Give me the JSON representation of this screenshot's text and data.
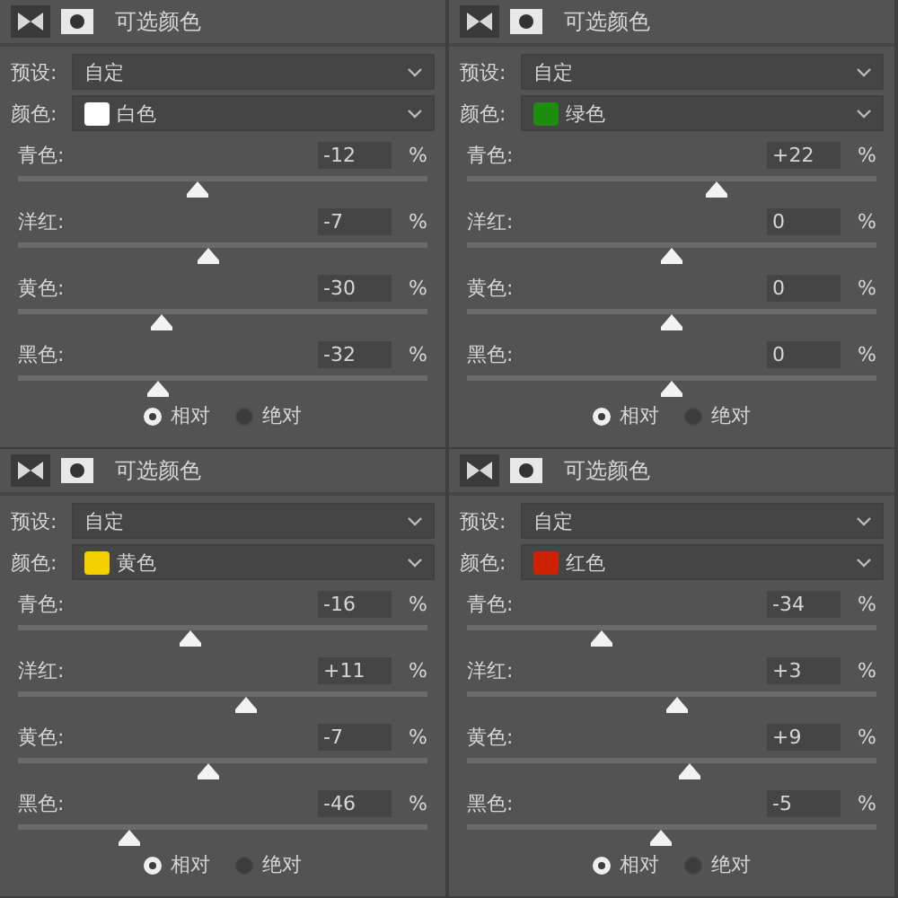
{
  "panels": [
    {
      "title": "可选颜色",
      "preset": {
        "label": "预设:",
        "value": "自定"
      },
      "color": {
        "label": "颜色:",
        "value": "白色",
        "color": "#ffffff"
      },
      "sliders": [
        {
          "label": "青色:",
          "value": "-12",
          "unit": "%",
          "level": 0.44
        },
        {
          "label": "洋红:",
          "value": "-7",
          "unit": "%",
          "level": 0.465
        },
        {
          "label": "黄色:",
          "value": "-30",
          "unit": "%",
          "level": 0.35
        },
        {
          "label": "黑色:",
          "value": "-32",
          "unit": "%",
          "level": 0.34
        }
      ],
      "radios": [
        {
          "label": "相对",
          "selected": true
        },
        {
          "label": "绝对",
          "selected": false
        }
      ]
    },
    {
      "title": "可选颜色",
      "preset": {
        "label": "预设:",
        "value": "自定"
      },
      "color": {
        "label": "颜色:",
        "value": "绿色",
        "color": "#1e8c10"
      },
      "sliders": [
        {
          "label": "青色:",
          "value": "+22",
          "unit": "%",
          "level": 0.61
        },
        {
          "label": "洋红:",
          "value": "0",
          "unit": "%",
          "level": 0.5
        },
        {
          "label": "黄色:",
          "value": "0",
          "unit": "%",
          "level": 0.5
        },
        {
          "label": "黑色:",
          "value": "0",
          "unit": "%",
          "level": 0.5
        }
      ],
      "radios": [
        {
          "label": "相对",
          "selected": true
        },
        {
          "label": "绝对",
          "selected": false
        }
      ]
    },
    {
      "title": "可选颜色",
      "preset": {
        "label": "预设:",
        "value": "自定"
      },
      "color": {
        "label": "颜色:",
        "value": "黄色",
        "color": "#f4d000"
      },
      "sliders": [
        {
          "label": "青色:",
          "value": "-16",
          "unit": "%",
          "level": 0.42
        },
        {
          "label": "洋红:",
          "value": "+11",
          "unit": "%",
          "level": 0.555
        },
        {
          "label": "黄色:",
          "value": "-7",
          "unit": "%",
          "level": 0.465
        },
        {
          "label": "黑色:",
          "value": "-46",
          "unit": "%",
          "level": 0.27
        }
      ],
      "radios": [
        {
          "label": "相对",
          "selected": true
        },
        {
          "label": "绝对",
          "selected": false
        }
      ]
    },
    {
      "title": "可选颜色",
      "preset": {
        "label": "预设:",
        "value": "自定"
      },
      "color": {
        "label": "颜色:",
        "value": "红色",
        "color": "#cc2200"
      },
      "sliders": [
        {
          "label": "青色:",
          "value": "-34",
          "unit": "%",
          "level": 0.33
        },
        {
          "label": "洋红:",
          "value": "+3",
          "unit": "%",
          "level": 0.515
        },
        {
          "label": "黄色:",
          "value": "+9",
          "unit": "%",
          "level": 0.545
        },
        {
          "label": "黑色:",
          "value": "-5",
          "unit": "%",
          "level": 0.475
        }
      ],
      "radios": [
        {
          "label": "相对",
          "selected": true
        },
        {
          "label": "绝对",
          "selected": false
        }
      ]
    }
  ]
}
